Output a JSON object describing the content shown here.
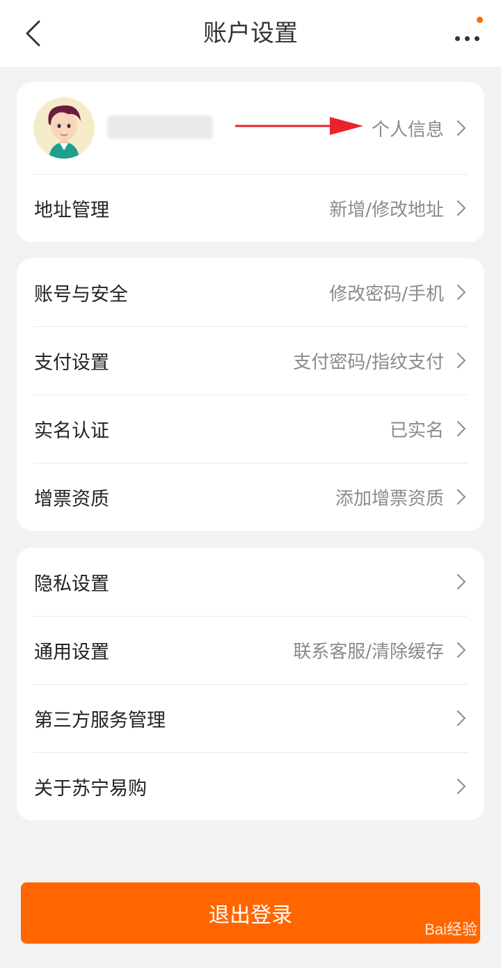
{
  "header": {
    "title": "账户设置",
    "back_icon": "chevron-left-icon",
    "more_icon": "more-dots-icon",
    "notify_color": "#ff6a00"
  },
  "profile": {
    "link_label": "个人信息"
  },
  "section1": [
    {
      "label": "地址管理",
      "value": "新增/修改地址"
    }
  ],
  "section2": [
    {
      "label": "账号与安全",
      "value": "修改密码/手机"
    },
    {
      "label": "支付设置",
      "value": "支付密码/指纹支付"
    },
    {
      "label": "实名认证",
      "value": "已实名"
    },
    {
      "label": "增票资质",
      "value": "添加增票资质"
    }
  ],
  "section3": [
    {
      "label": "隐私设置",
      "value": ""
    },
    {
      "label": "通用设置",
      "value": "联系客服/清除缓存"
    },
    {
      "label": "第三方服务管理",
      "value": ""
    },
    {
      "label": "关于苏宁易购",
      "value": ""
    }
  ],
  "logout_label": "退出登录",
  "accent_color": "#ff6600",
  "watermark": "Bai经验"
}
